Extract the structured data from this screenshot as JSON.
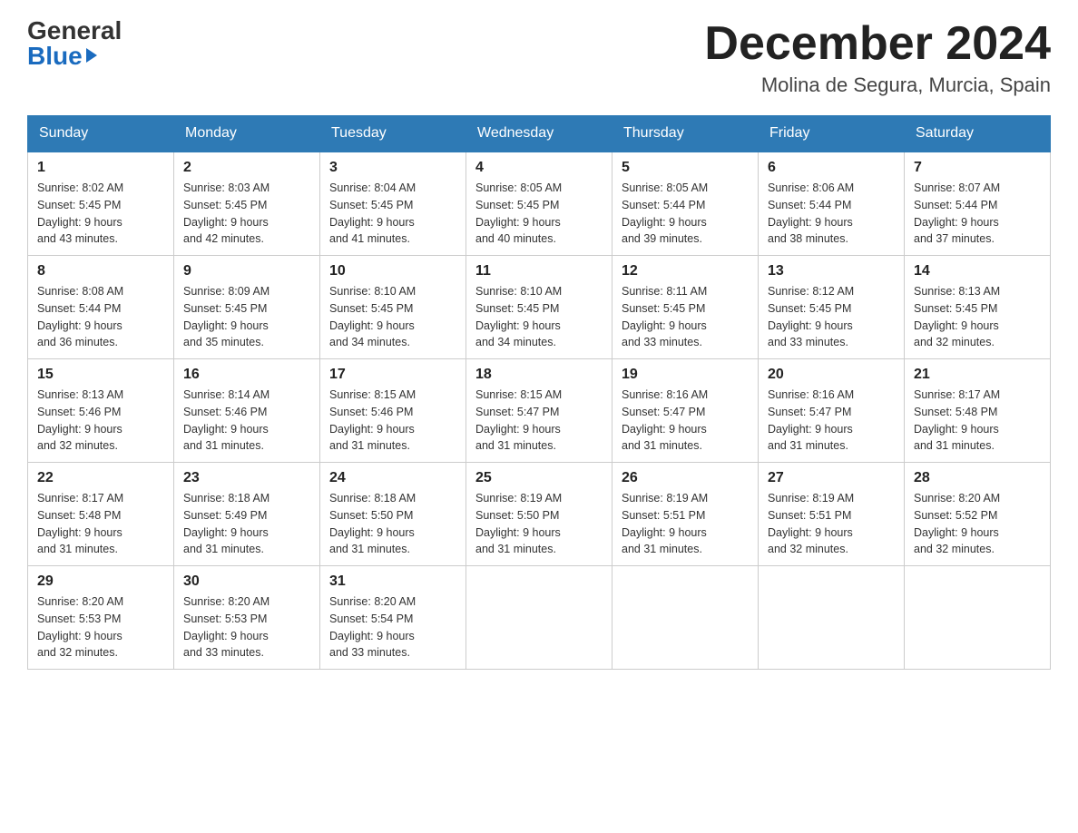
{
  "header": {
    "logo_general": "General",
    "logo_blue": "Blue",
    "month_title": "December 2024",
    "location": "Molina de Segura, Murcia, Spain"
  },
  "days_of_week": [
    "Sunday",
    "Monday",
    "Tuesday",
    "Wednesday",
    "Thursday",
    "Friday",
    "Saturday"
  ],
  "weeks": [
    [
      {
        "day": "1",
        "sunrise": "Sunrise: 8:02 AM",
        "sunset": "Sunset: 5:45 PM",
        "daylight": "Daylight: 9 hours",
        "minutes": "and 43 minutes."
      },
      {
        "day": "2",
        "sunrise": "Sunrise: 8:03 AM",
        "sunset": "Sunset: 5:45 PM",
        "daylight": "Daylight: 9 hours",
        "minutes": "and 42 minutes."
      },
      {
        "day": "3",
        "sunrise": "Sunrise: 8:04 AM",
        "sunset": "Sunset: 5:45 PM",
        "daylight": "Daylight: 9 hours",
        "minutes": "and 41 minutes."
      },
      {
        "day": "4",
        "sunrise": "Sunrise: 8:05 AM",
        "sunset": "Sunset: 5:45 PM",
        "daylight": "Daylight: 9 hours",
        "minutes": "and 40 minutes."
      },
      {
        "day": "5",
        "sunrise": "Sunrise: 8:05 AM",
        "sunset": "Sunset: 5:44 PM",
        "daylight": "Daylight: 9 hours",
        "minutes": "and 39 minutes."
      },
      {
        "day": "6",
        "sunrise": "Sunrise: 8:06 AM",
        "sunset": "Sunset: 5:44 PM",
        "daylight": "Daylight: 9 hours",
        "minutes": "and 38 minutes."
      },
      {
        "day": "7",
        "sunrise": "Sunrise: 8:07 AM",
        "sunset": "Sunset: 5:44 PM",
        "daylight": "Daylight: 9 hours",
        "minutes": "and 37 minutes."
      }
    ],
    [
      {
        "day": "8",
        "sunrise": "Sunrise: 8:08 AM",
        "sunset": "Sunset: 5:44 PM",
        "daylight": "Daylight: 9 hours",
        "minutes": "and 36 minutes."
      },
      {
        "day": "9",
        "sunrise": "Sunrise: 8:09 AM",
        "sunset": "Sunset: 5:45 PM",
        "daylight": "Daylight: 9 hours",
        "minutes": "and 35 minutes."
      },
      {
        "day": "10",
        "sunrise": "Sunrise: 8:10 AM",
        "sunset": "Sunset: 5:45 PM",
        "daylight": "Daylight: 9 hours",
        "minutes": "and 34 minutes."
      },
      {
        "day": "11",
        "sunrise": "Sunrise: 8:10 AM",
        "sunset": "Sunset: 5:45 PM",
        "daylight": "Daylight: 9 hours",
        "minutes": "and 34 minutes."
      },
      {
        "day": "12",
        "sunrise": "Sunrise: 8:11 AM",
        "sunset": "Sunset: 5:45 PM",
        "daylight": "Daylight: 9 hours",
        "minutes": "and 33 minutes."
      },
      {
        "day": "13",
        "sunrise": "Sunrise: 8:12 AM",
        "sunset": "Sunset: 5:45 PM",
        "daylight": "Daylight: 9 hours",
        "minutes": "and 33 minutes."
      },
      {
        "day": "14",
        "sunrise": "Sunrise: 8:13 AM",
        "sunset": "Sunset: 5:45 PM",
        "daylight": "Daylight: 9 hours",
        "minutes": "and 32 minutes."
      }
    ],
    [
      {
        "day": "15",
        "sunrise": "Sunrise: 8:13 AM",
        "sunset": "Sunset: 5:46 PM",
        "daylight": "Daylight: 9 hours",
        "minutes": "and 32 minutes."
      },
      {
        "day": "16",
        "sunrise": "Sunrise: 8:14 AM",
        "sunset": "Sunset: 5:46 PM",
        "daylight": "Daylight: 9 hours",
        "minutes": "and 31 minutes."
      },
      {
        "day": "17",
        "sunrise": "Sunrise: 8:15 AM",
        "sunset": "Sunset: 5:46 PM",
        "daylight": "Daylight: 9 hours",
        "minutes": "and 31 minutes."
      },
      {
        "day": "18",
        "sunrise": "Sunrise: 8:15 AM",
        "sunset": "Sunset: 5:47 PM",
        "daylight": "Daylight: 9 hours",
        "minutes": "and 31 minutes."
      },
      {
        "day": "19",
        "sunrise": "Sunrise: 8:16 AM",
        "sunset": "Sunset: 5:47 PM",
        "daylight": "Daylight: 9 hours",
        "minutes": "and 31 minutes."
      },
      {
        "day": "20",
        "sunrise": "Sunrise: 8:16 AM",
        "sunset": "Sunset: 5:47 PM",
        "daylight": "Daylight: 9 hours",
        "minutes": "and 31 minutes."
      },
      {
        "day": "21",
        "sunrise": "Sunrise: 8:17 AM",
        "sunset": "Sunset: 5:48 PM",
        "daylight": "Daylight: 9 hours",
        "minutes": "and 31 minutes."
      }
    ],
    [
      {
        "day": "22",
        "sunrise": "Sunrise: 8:17 AM",
        "sunset": "Sunset: 5:48 PM",
        "daylight": "Daylight: 9 hours",
        "minutes": "and 31 minutes."
      },
      {
        "day": "23",
        "sunrise": "Sunrise: 8:18 AM",
        "sunset": "Sunset: 5:49 PM",
        "daylight": "Daylight: 9 hours",
        "minutes": "and 31 minutes."
      },
      {
        "day": "24",
        "sunrise": "Sunrise: 8:18 AM",
        "sunset": "Sunset: 5:50 PM",
        "daylight": "Daylight: 9 hours",
        "minutes": "and 31 minutes."
      },
      {
        "day": "25",
        "sunrise": "Sunrise: 8:19 AM",
        "sunset": "Sunset: 5:50 PM",
        "daylight": "Daylight: 9 hours",
        "minutes": "and 31 minutes."
      },
      {
        "day": "26",
        "sunrise": "Sunrise: 8:19 AM",
        "sunset": "Sunset: 5:51 PM",
        "daylight": "Daylight: 9 hours",
        "minutes": "and 31 minutes."
      },
      {
        "day": "27",
        "sunrise": "Sunrise: 8:19 AM",
        "sunset": "Sunset: 5:51 PM",
        "daylight": "Daylight: 9 hours",
        "minutes": "and 32 minutes."
      },
      {
        "day": "28",
        "sunrise": "Sunrise: 8:20 AM",
        "sunset": "Sunset: 5:52 PM",
        "daylight": "Daylight: 9 hours",
        "minutes": "and 32 minutes."
      }
    ],
    [
      {
        "day": "29",
        "sunrise": "Sunrise: 8:20 AM",
        "sunset": "Sunset: 5:53 PM",
        "daylight": "Daylight: 9 hours",
        "minutes": "and 32 minutes."
      },
      {
        "day": "30",
        "sunrise": "Sunrise: 8:20 AM",
        "sunset": "Sunset: 5:53 PM",
        "daylight": "Daylight: 9 hours",
        "minutes": "and 33 minutes."
      },
      {
        "day": "31",
        "sunrise": "Sunrise: 8:20 AM",
        "sunset": "Sunset: 5:54 PM",
        "daylight": "Daylight: 9 hours",
        "minutes": "and 33 minutes."
      },
      null,
      null,
      null,
      null
    ]
  ]
}
